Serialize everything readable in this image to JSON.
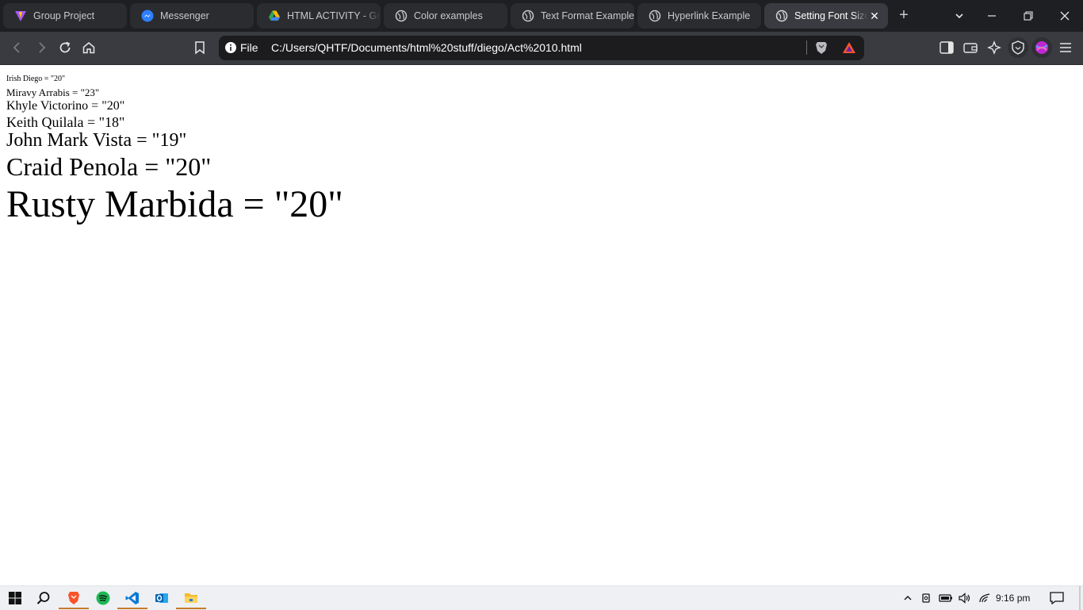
{
  "tabs": [
    {
      "label": "Group Project",
      "icon": "vite-logo-icon"
    },
    {
      "label": "Messenger",
      "icon": "messenger-icon"
    },
    {
      "label": "HTML ACTIVITY - Go",
      "icon": "google-drive-icon"
    },
    {
      "label": "Color examples",
      "icon": "globe-icon"
    },
    {
      "label": "Text Format Example",
      "icon": "globe-icon"
    },
    {
      "label": "Hyperlink Example",
      "icon": "globe-icon"
    },
    {
      "label": "Setting Font Size",
      "icon": "globe-icon",
      "active": true
    }
  ],
  "address_bar": {
    "scheme_label": "File",
    "url": "C:/Users/QHTF/Documents/html%20stuff/diego/Act%2010.html"
  },
  "content": {
    "lines": [
      "Irish Diego = \"20\"",
      "Miravy Arrabis = \"23\"",
      "Khyle Victorino = \"20\"",
      "Keith Quilala = \"18\"",
      "John Mark Vista = \"19\"",
      "Craid Penola = \"20\"",
      "Rusty Marbida = \"20\""
    ]
  },
  "taskbar": {
    "clock": "9:16 pm",
    "apps": [
      "start-icon",
      "search-icon",
      "brave-icon",
      "spotify-icon",
      "vscode-icon",
      "outlook-icon",
      "file-explorer-icon"
    ]
  },
  "colors": {
    "tabstrip_bg": "#1e1f22",
    "toolbar_bg": "#3a3b40",
    "accent_brave": "#fb542b"
  }
}
